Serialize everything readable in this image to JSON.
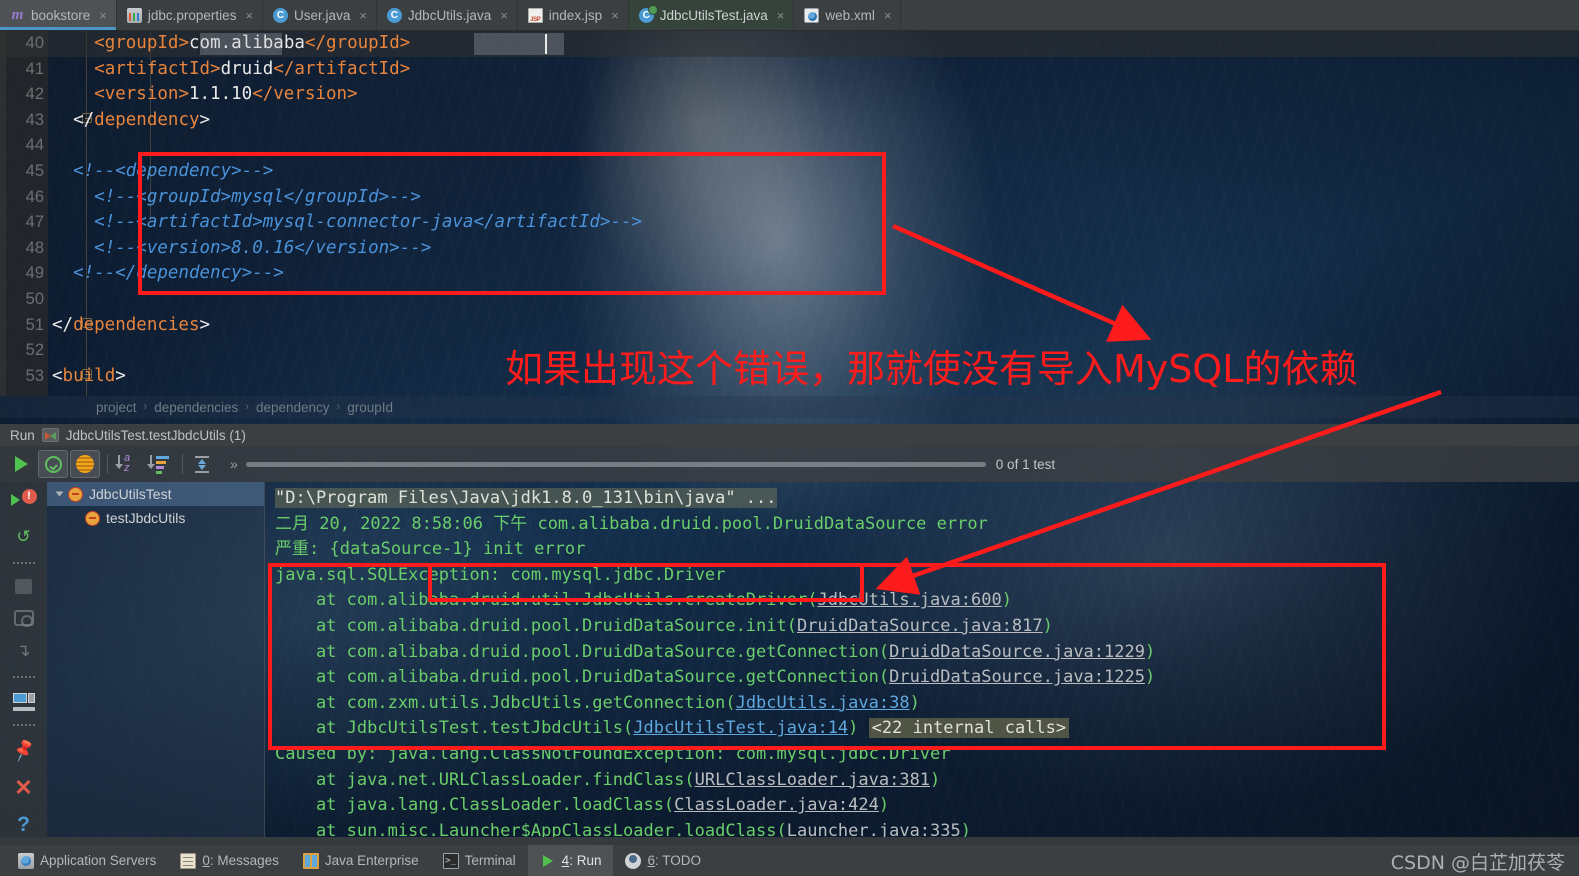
{
  "tabs": [
    {
      "label": "bookstore",
      "icon": "maven-m-icon",
      "state": "selected"
    },
    {
      "label": "jdbc.properties",
      "icon": "properties-file-icon",
      "state": "normal"
    },
    {
      "label": "User.java",
      "icon": "java-class-icon",
      "state": "normal"
    },
    {
      "label": "JdbcUtils.java",
      "icon": "java-class-icon",
      "state": "normal"
    },
    {
      "label": "index.jsp",
      "icon": "jsp-file-icon",
      "state": "normal"
    },
    {
      "label": "JdbcUtilsTest.java",
      "icon": "java-test-class-icon",
      "state": "active"
    },
    {
      "label": "web.xml",
      "icon": "xml-file-icon",
      "state": "normal"
    }
  ],
  "tab_close_glyph": "×",
  "editor": {
    "lines": [
      {
        "num": "40",
        "current": true,
        "segs": [
          {
            "t": "    ",
            "c": "txt"
          },
          {
            "t": "<",
            "c": "tag"
          },
          {
            "t": "groupId",
            "c": "tag"
          },
          {
            "t": ">",
            "c": "tag"
          },
          {
            "t": "com.alibaba",
            "c": "txt"
          },
          {
            "t": "</",
            "c": "tag"
          },
          {
            "t": "groupId",
            "c": "tag"
          },
          {
            "t": ">",
            "c": "tag"
          }
        ]
      },
      {
        "num": "41",
        "current": false,
        "segs": [
          {
            "t": "    ",
            "c": "txt"
          },
          {
            "t": "<artifactId>",
            "c": "tag"
          },
          {
            "t": "druid",
            "c": "txt"
          },
          {
            "t": "</artifactId>",
            "c": "tag"
          }
        ]
      },
      {
        "num": "42",
        "current": false,
        "segs": [
          {
            "t": "    ",
            "c": "txt"
          },
          {
            "t": "<version>",
            "c": "tag"
          },
          {
            "t": "1.1.10",
            "c": "txt"
          },
          {
            "t": "</version>",
            "c": "tag"
          }
        ]
      },
      {
        "num": "43",
        "current": false,
        "segs": [
          {
            "t": "  ",
            "c": "txt"
          },
          {
            "t": "</",
            "c": "txt"
          },
          {
            "t": "dependency",
            "c": "tag"
          },
          {
            "t": ">",
            "c": "txt"
          }
        ]
      },
      {
        "num": "44",
        "current": false,
        "segs": []
      },
      {
        "num": "45",
        "current": false,
        "segs": [
          {
            "t": "  ",
            "c": "txt"
          },
          {
            "t": "<!--<dependency>-->",
            "c": "cmt"
          }
        ]
      },
      {
        "num": "46",
        "current": false,
        "segs": [
          {
            "t": "    ",
            "c": "txt"
          },
          {
            "t": "<!--<groupId>mysql</groupId>-->",
            "c": "cmt"
          }
        ]
      },
      {
        "num": "47",
        "current": false,
        "segs": [
          {
            "t": "    ",
            "c": "txt"
          },
          {
            "t": "<!--<artifactId>mysql-connector-java</artifactId>-->",
            "c": "cmt"
          }
        ]
      },
      {
        "num": "48",
        "current": false,
        "segs": [
          {
            "t": "    ",
            "c": "txt"
          },
          {
            "t": "<!--<version>8.0.16</version>-->",
            "c": "cmt"
          }
        ]
      },
      {
        "num": "49",
        "current": false,
        "segs": [
          {
            "t": "  ",
            "c": "txt"
          },
          {
            "t": "<!--</dependency>-->",
            "c": "cmt"
          }
        ]
      },
      {
        "num": "50",
        "current": false,
        "segs": []
      },
      {
        "num": "51",
        "current": false,
        "segs": [
          {
            "t": "",
            "c": "txt"
          },
          {
            "t": "</",
            "c": "txt"
          },
          {
            "t": "dependencies",
            "c": "tag"
          },
          {
            "t": ">",
            "c": "txt"
          }
        ]
      },
      {
        "num": "52",
        "current": false,
        "segs": []
      },
      {
        "num": "53",
        "current": false,
        "segs": [
          {
            "t": "",
            "c": "txt"
          },
          {
            "t": "<",
            "c": "txt"
          },
          {
            "t": "build",
            "c": "tag"
          },
          {
            "t": ">",
            "c": "txt"
          }
        ]
      }
    ]
  },
  "breadcrumb": {
    "items": [
      "project",
      "dependencies",
      "dependency",
      "groupId"
    ],
    "separator": "›"
  },
  "run_header": {
    "label": "Run",
    "config": "JdbcUtilsTest.testJbdcUtils (1)"
  },
  "run_toolbar": {
    "rerun_label": "rerun",
    "show_passed_label": "show-passed",
    "show_ignored_label": "show-ignored",
    "sort_alpha_label": "sort-alphabetically",
    "sort_duration_label": "sort-by-duration",
    "expand_label": "expand-collapse",
    "more_glyph": "»",
    "test_count": "0 of 1 test"
  },
  "test_tree": [
    {
      "label": "JdbcUtilsTest",
      "level": 0,
      "status": "failed",
      "expanded": true,
      "selected": true
    },
    {
      "label": "testJbdcUtils",
      "level": 1,
      "status": "failed",
      "expanded": false,
      "selected": false
    }
  ],
  "console": [
    {
      "parts": [
        {
          "t": "\"D:\\Program Files\\Java\\jdk1.8.0_131\\bin\\java\" ...",
          "s": "hl"
        }
      ]
    },
    {
      "parts": [
        {
          "t": "二月 20, 2022 8:58:06 下午 com.alibaba.druid.pool.DruidDataSource error",
          "s": "g"
        }
      ]
    },
    {
      "parts": [
        {
          "t": "严重: {dataSource-1} init error",
          "s": "g"
        }
      ]
    },
    {
      "parts": [
        {
          "t": "java.sql.SQLException: com.mysql.jdbc.Driver",
          "s": "g"
        }
      ]
    },
    {
      "parts": [
        {
          "t": "    at com.alibaba.druid.util.JdbcUtils.createDriver(",
          "s": "g"
        },
        {
          "t": "JdbcUtils.java:600",
          "s": "lnk-g"
        },
        {
          "t": ")",
          "s": "g"
        }
      ]
    },
    {
      "parts": [
        {
          "t": "    at com.alibaba.druid.pool.DruidDataSource.init(",
          "s": "g"
        },
        {
          "t": "DruidDataSource.java:817",
          "s": "lnk-g"
        },
        {
          "t": ")",
          "s": "g"
        }
      ]
    },
    {
      "parts": [
        {
          "t": "    at com.alibaba.druid.pool.DruidDataSource.getConnection(",
          "s": "g"
        },
        {
          "t": "DruidDataSource.java:1229",
          "s": "lnk-g"
        },
        {
          "t": ")",
          "s": "g"
        }
      ]
    },
    {
      "parts": [
        {
          "t": "    at com.alibaba.druid.pool.DruidDataSource.getConnection(",
          "s": "g"
        },
        {
          "t": "DruidDataSource.java:1225",
          "s": "lnk-g"
        },
        {
          "t": ")",
          "s": "g"
        }
      ]
    },
    {
      "parts": [
        {
          "t": "    at com.zxm.utils.JdbcUtils.getConnection(",
          "s": "g"
        },
        {
          "t": "JdbcUtils.java:38",
          "s": "lnk"
        },
        {
          "t": ")",
          "s": "g"
        }
      ]
    },
    {
      "parts": [
        {
          "t": "    at JdbcUtilsTest.testJbdcUtils(",
          "s": "g"
        },
        {
          "t": "JdbcUtilsTest.java:14",
          "s": "lnk"
        },
        {
          "t": ") ",
          "s": "g"
        },
        {
          "t": "<22 internal calls>",
          "s": "chip"
        }
      ]
    },
    {
      "parts": [
        {
          "t": "Caused by: java.lang.ClassNotFoundException: com.mysql.jdbc.Driver",
          "s": "g"
        }
      ]
    },
    {
      "parts": [
        {
          "t": "    at java.net.URLClassLoader.findClass(",
          "s": "g"
        },
        {
          "t": "URLClassLoader.java:381",
          "s": "lnk-g"
        },
        {
          "t": ")",
          "s": "g"
        }
      ]
    },
    {
      "parts": [
        {
          "t": "    at java.lang.ClassLoader.loadClass(",
          "s": "g"
        },
        {
          "t": "ClassLoader.java:424",
          "s": "lnk-g"
        },
        {
          "t": ")",
          "s": "g"
        }
      ]
    },
    {
      "parts": [
        {
          "t": "    at sun.misc.Launcher$AppClassLoader.loadClass(",
          "s": "g"
        },
        {
          "t": "Launcher.java:335",
          "s": "lnk-g"
        },
        {
          "t": ")",
          "s": "g"
        }
      ]
    }
  ],
  "annotation": {
    "text": "如果出现这个错误，那就使没有导入MySQL的依赖",
    "color": "#fd1b1b"
  },
  "status_bar": [
    {
      "label": "Application Servers",
      "icon": "application-servers-icon",
      "mnemonic": "",
      "active": false
    },
    {
      "label": ": Messages",
      "icon": "messages-icon",
      "mnemonic": "0",
      "active": false
    },
    {
      "label": "Java Enterprise",
      "icon": "java-enterprise-icon",
      "mnemonic": "",
      "active": false
    },
    {
      "label": "Terminal",
      "icon": "terminal-icon",
      "mnemonic": "",
      "active": false
    },
    {
      "label": ": Run",
      "icon": "run-icon",
      "mnemonic": "4",
      "active": true
    },
    {
      "label": ": TODO",
      "icon": "todo-icon",
      "mnemonic": "6",
      "active": false
    }
  ],
  "watermark": "CSDN @白芷加茯苓"
}
